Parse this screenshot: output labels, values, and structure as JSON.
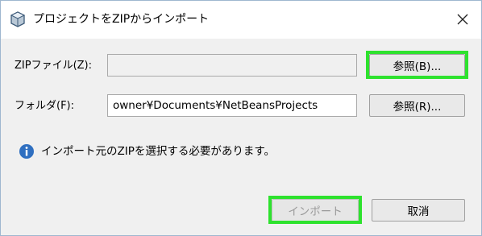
{
  "window": {
    "title": "プロジェクトをZIPからインポート",
    "close_icon": "close-icon",
    "app_icon": "cube-icon"
  },
  "zip_row": {
    "label": "ZIPファイル(Z):",
    "value": "",
    "browse_label": "参照(B)..."
  },
  "folder_row": {
    "label": "フォルダ(F):",
    "value": "owner¥Documents¥NetBeansProjects",
    "browse_label": "参照(R)..."
  },
  "message": {
    "icon": "info-icon",
    "text": "インポート元のZIPを選択する必要があります。"
  },
  "footer": {
    "import_label": "インポート",
    "import_enabled": false,
    "cancel_label": "取消"
  },
  "colors": {
    "highlight": "#2ee22e",
    "info_icon": "#2f6fc0"
  }
}
